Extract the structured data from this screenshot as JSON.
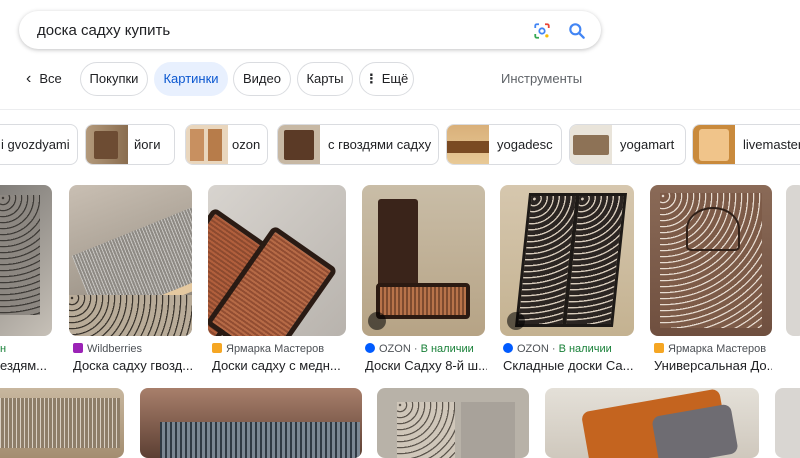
{
  "search": {
    "query": "доска садху купить"
  },
  "tabs": {
    "back": "Все",
    "items": [
      {
        "label": "Покупки"
      },
      {
        "label": "Картинки"
      },
      {
        "label": "Видео"
      },
      {
        "label": "Карты"
      },
      {
        "label": "Ещё"
      }
    ],
    "tools": "Инструменты"
  },
  "chips": [
    {
      "label": "i gvozdyami"
    },
    {
      "label": "йоги"
    },
    {
      "label": "ozon"
    },
    {
      "label": "с гвоздями садху"
    },
    {
      "label": "yogadesc"
    },
    {
      "label": "yogamart"
    },
    {
      "label": "livemaster"
    }
  ],
  "results": [
    {
      "source": "",
      "title": "ездям..."
    },
    {
      "source": "Wildberries",
      "title": "Доска садху гвозд..."
    },
    {
      "source": "Ярмарка Мастеров",
      "title": "Доски садху с медн..."
    },
    {
      "source": "OZON",
      "availability": "В наличии",
      "title": "Доски Садху 8-й ш..."
    },
    {
      "source": "OZON",
      "availability": "В наличии",
      "title": "Складные доски Са..."
    },
    {
      "source": "Ярмарка Мастеров",
      "title": "Универсальная До..."
    }
  ],
  "colors": {
    "accent": "#0b57d0",
    "active_tab_bg": "#e8f0fe",
    "in_stock": "#188038"
  }
}
